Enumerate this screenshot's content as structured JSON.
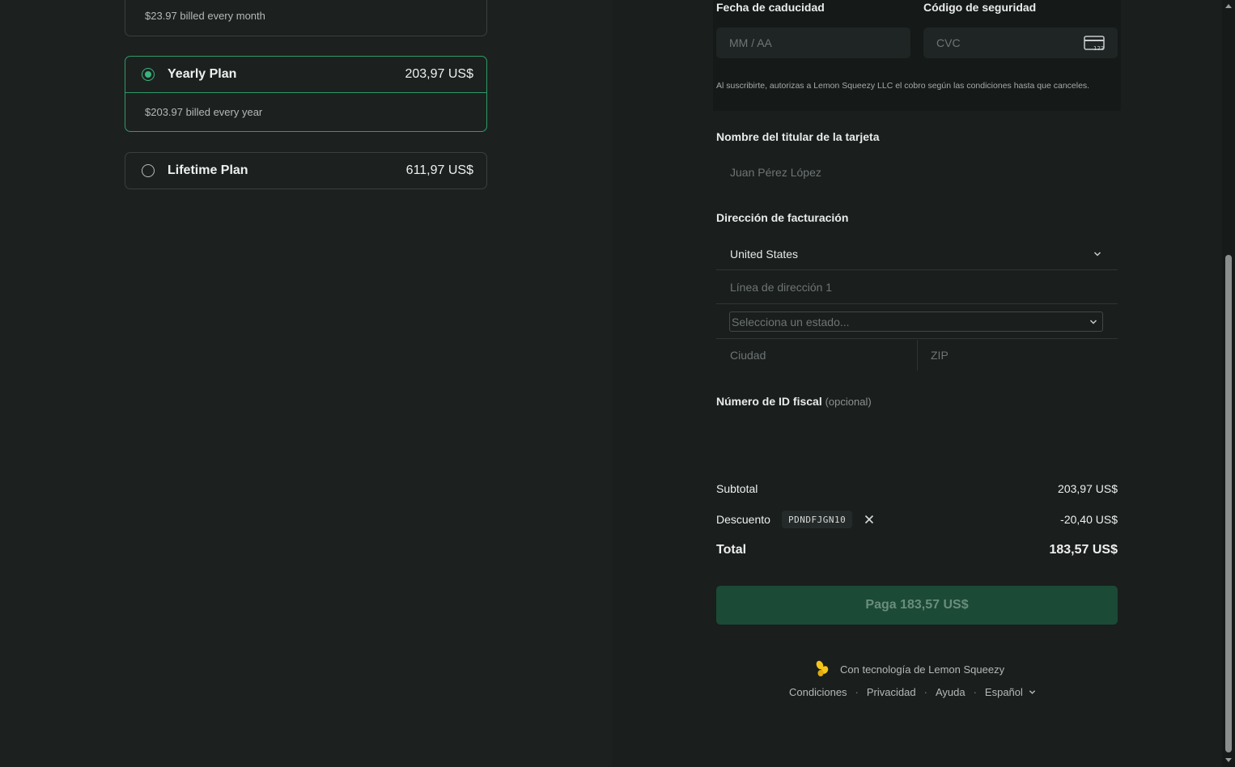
{
  "plans": {
    "monthly_billing": "$23.97 billed every month",
    "yearly": {
      "name": "Yearly Plan",
      "price": "203,97 US$",
      "billing": "$203.97 billed every year"
    },
    "lifetime": {
      "name": "Lifetime Plan",
      "price": "611,97 US$"
    }
  },
  "card": {
    "expiry_label": "Fecha de caducidad",
    "expiry_placeholder": "MM / AA",
    "cvc_label": "Código de seguridad",
    "cvc_placeholder": "CVC",
    "consent": "Al suscribirte, autorizas a Lemon Squeezy LLC el cobro según las condiciones hasta que canceles."
  },
  "holder": {
    "label": "Nombre del titular de la tarjeta",
    "placeholder": "Juan Pérez López"
  },
  "billing": {
    "label": "Dirección de facturación",
    "country": "United States",
    "address_placeholder": "Línea de dirección 1",
    "state_placeholder": "Selecciona un estado...",
    "city_placeholder": "Ciudad",
    "zip_placeholder": "ZIP"
  },
  "tax": {
    "label": "Número de ID fiscal",
    "optional": "(opcional)"
  },
  "summary": {
    "subtotal_label": "Subtotal",
    "subtotal_value": "203,97 US$",
    "discount_label": "Descuento",
    "discount_code": "PDNDFJGN10",
    "discount_value": "-20,40 US$",
    "total_label": "Total",
    "total_value": "183,57 US$"
  },
  "pay_button": "Paga 183,57 US$",
  "footer": {
    "powered": "Con tecnología de Lemon Squeezy",
    "terms": "Condiciones",
    "privacy": "Privacidad",
    "help": "Ayuda",
    "language": "Español"
  },
  "colors": {
    "accent": "#3ab47a",
    "button_bg": "#1b4a36",
    "lemon": "#f5c518"
  }
}
